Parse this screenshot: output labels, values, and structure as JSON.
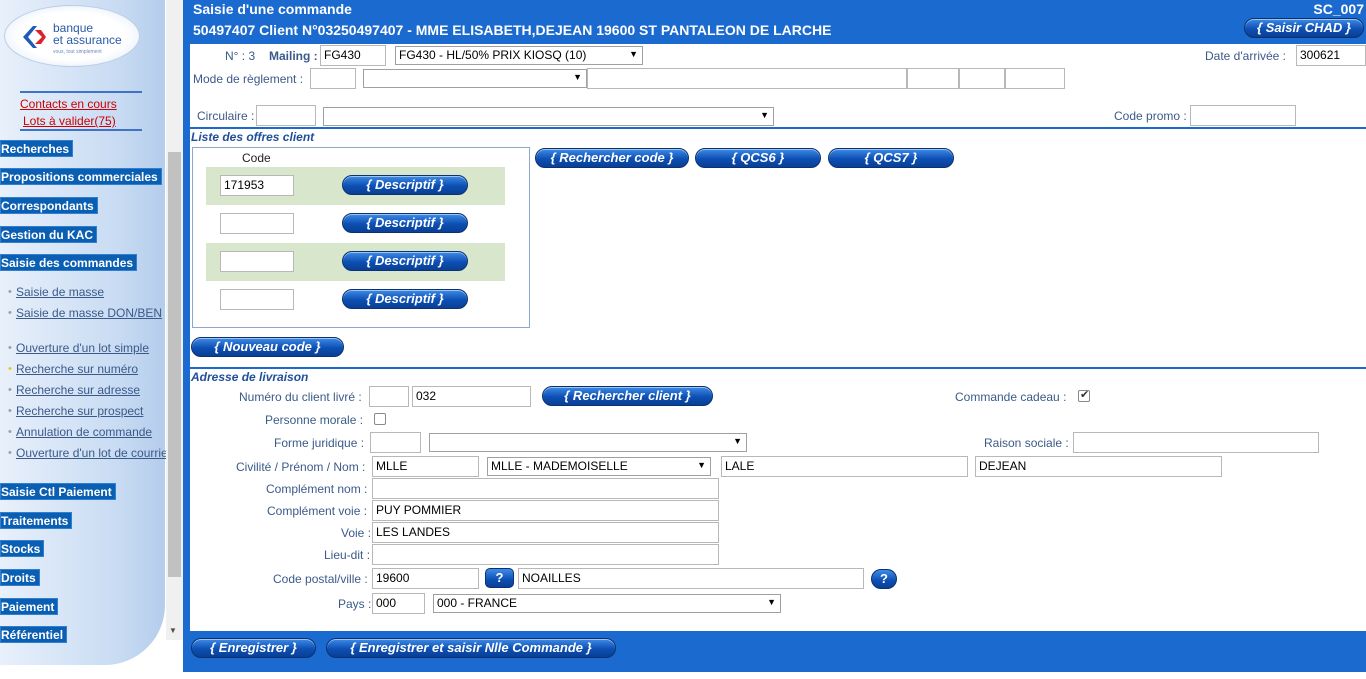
{
  "sidebar": {
    "logo": {
      "line1": "banque",
      "line2": "et assurance",
      "line3": "vous, tout simplement"
    },
    "alerts": [
      "Contacts en cours",
      "Lots à valider(75)"
    ],
    "sections": {
      "recherches": "Recherches",
      "propositions": "Propositions commerciales",
      "correspondants": "Correspondants",
      "gestion_kac": "Gestion du KAC",
      "saisie_commandes": "Saisie des commandes",
      "saisie_ctl": "Saisie Ctl Paiement",
      "traitements": "Traitements",
      "stocks": "Stocks",
      "droits": "Droits",
      "paiement": "Paiement",
      "referentiel": "Référentiel"
    },
    "sub_items": [
      "Saisie de masse",
      "Saisie de masse DON/BEN",
      "Ouverture d'un lot simple",
      "Recherche sur numéro",
      "Recherche sur adresse",
      "Recherche sur prospect",
      "Annulation de commande",
      "Ouverture d'un lot de courriers"
    ]
  },
  "header": {
    "title": "Saisie d'une commande",
    "screen_code": "SC_007",
    "client_line": "50497407 Client N°03250497407 - MME ELISABETH,DEJEAN 19600 ST PANTALEON DE LARCHE",
    "chad_button": "{ Saisir CHAD }"
  },
  "order": {
    "numero_label": "N° : 3",
    "mailing_label": "Mailing :",
    "mailing_code": "FG430",
    "mailing_select": "FG430 - HL/50% PRIX KIOSQ (10)",
    "date_label": "Date d'arrivée :",
    "date_value": "300621",
    "reglement_label": "Mode de règlement :",
    "reglement_code": "",
    "reglement_select": "",
    "circulaire_label": "Circulaire :",
    "circulaire_code": "",
    "circulaire_select": "",
    "promo_label": "Code promo :",
    "promo_value": ""
  },
  "offers": {
    "section_title": "Liste des offres client",
    "code_header": "Code",
    "codes": [
      "171953",
      "",
      "",
      ""
    ],
    "descriptif_label": "{ Descriptif }",
    "rechercher_code": "{ Rechercher code }",
    "qcs6": "{ QCS6 }",
    "qcs7": "{ QCS7 }",
    "nouveau_code": "{ Nouveau code }"
  },
  "delivery": {
    "section_title": "Adresse de livraison",
    "numero_client_label": "Numéro du client livré :",
    "numero_client_prefix": "",
    "numero_client_value": "032",
    "rechercher_client": "{ Rechercher client }",
    "cadeau_label": "Commande cadeau :",
    "cadeau_checked": true,
    "personne_morale_label": "Personne morale :",
    "forme_juridique_label": "Forme juridique :",
    "forme_juridique_code": "",
    "forme_juridique_select": "",
    "raison_sociale_label": "Raison sociale :",
    "raison_sociale_value": "",
    "civilite_label": "Civilité / Prénom / Nom :",
    "civilite_code": "MLLE",
    "civilite_select": "MLLE - MADEMOISELLE",
    "prenom": "LALE",
    "nom": "DEJEAN",
    "complement_nom_label": "Complément nom :",
    "complement_nom": "",
    "complement_voie_label": "Complément voie :",
    "complement_voie": "PUY POMMIER",
    "voie_label": "Voie :",
    "voie": "LES LANDES",
    "lieu_dit_label": "Lieu-dit :",
    "lieu_dit": "",
    "code_postal_label": "Code postal/ville :",
    "code_postal": "19600",
    "ville": "NOAILLES",
    "help_glyph": "?",
    "pays_label": "Pays :",
    "pays_code": "000",
    "pays_select": "000 - FRANCE"
  },
  "footer": {
    "enregistrer": "{ Enregistrer }",
    "enregistrer_nouvelle": "{ Enregistrer et saisir Nlle Commande }"
  },
  "colors": {
    "primary": "#1b6ad0",
    "button_dark": "#0d4fb3",
    "offer_row": "#d8e6cc",
    "alert": "#cc0000"
  }
}
